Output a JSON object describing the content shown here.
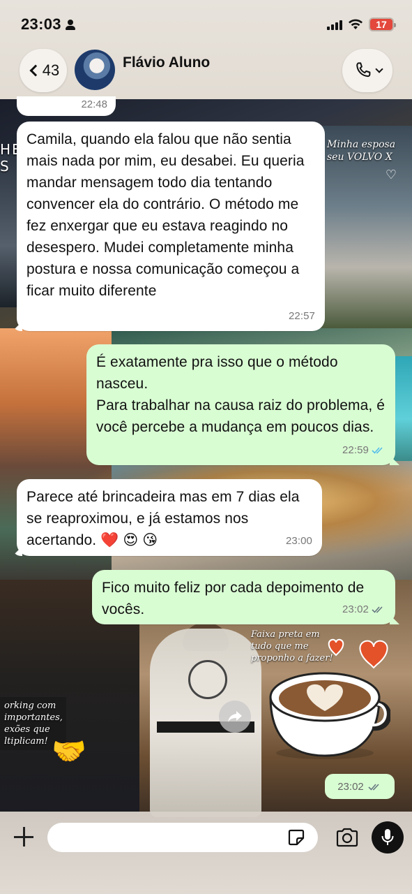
{
  "status_bar": {
    "time": "23:03",
    "battery": "17"
  },
  "header": {
    "back_count": "43",
    "contact_name": "Flávio Aluno"
  },
  "previous_message": {
    "time": "22:48"
  },
  "messages": [
    {
      "direction": "in",
      "text": "Camila, quando ela falou que não sentia mais nada por mim, eu desabei. Eu queria mandar mensagem todo dia tentando convencer ela do contrário. O método me fez enxergar que eu estava reagindo no desespero. Mudei completamente minha postura e nossa comunicação começou a ficar muito diferente",
      "time": "22:57"
    },
    {
      "direction": "out",
      "text": "É exatamente pra isso que o método nasceu.\nPara trabalhar na causa raiz do problema, é você percebe a mudança em poucos dias.",
      "time": "22:59",
      "status": "read"
    },
    {
      "direction": "in",
      "text": "Parece até brincadeira mas em 7 dias ela se reaproximou, e já estamos nos acertando. ❤️ 😍 😘",
      "time": "23:00"
    },
    {
      "direction": "out",
      "text": "Fico muito feliz por cada depoimento de vocês.",
      "time": "23:02",
      "status": "delivered"
    }
  ],
  "sticker": {
    "time": "23:02",
    "status": "delivered",
    "icon": "latte-heart-sticker"
  },
  "wallpaper": {
    "volvo_caption": "Minha esposa seu VOLVO X",
    "faixa_caption": "Faixa preta em tudo que me proponho a fazer!",
    "networking_caption": "orking com importantes, exões que ltiplicam!",
    "he_caption": "HE\nS"
  },
  "composer": {
    "placeholder": ""
  },
  "colors": {
    "incoming_bubble": "#ffffff",
    "outgoing_bubble": "#d9fdd3",
    "read_ticks": "#53bdeb",
    "delivered_ticks": "#667781",
    "battery_low": "#e4473b"
  }
}
